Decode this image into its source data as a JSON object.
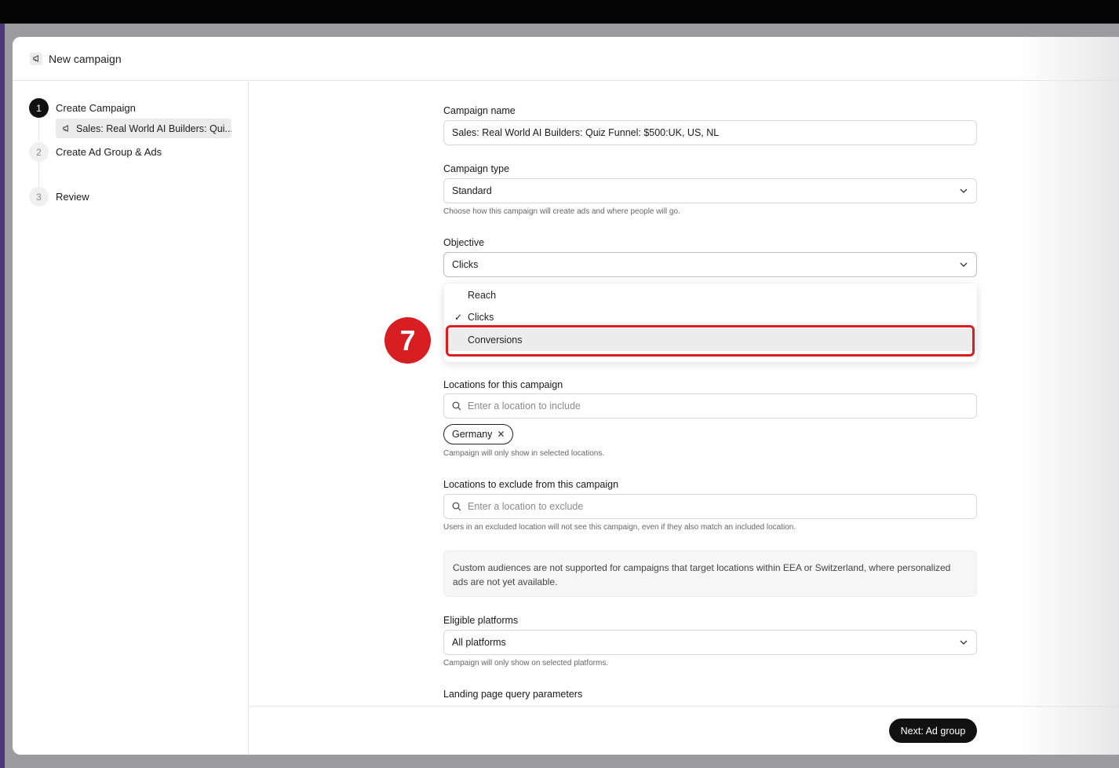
{
  "modal": {
    "title": "New campaign"
  },
  "steps": [
    {
      "num": "1",
      "label": "Create Campaign"
    },
    {
      "num": "2",
      "label": "Create Ad Group & Ads"
    },
    {
      "num": "3",
      "label": "Review"
    }
  ],
  "sub_item": "Sales: Real World AI Builders: Qui...",
  "form": {
    "campaign_name": {
      "label": "Campaign name",
      "value": "Sales: Real World AI Builders: Quiz Funnel: $500:UK, US, NL"
    },
    "campaign_type": {
      "label": "Campaign type",
      "value": "Standard",
      "helper": "Choose how this campaign will create ads and where people will go."
    },
    "objective": {
      "label": "Objective",
      "value": "Clicks",
      "options": [
        "Reach",
        "Clicks",
        "Conversions"
      ]
    },
    "locations": {
      "label": "Locations for this campaign",
      "placeholder": "Enter a location to include",
      "chip": "Germany",
      "helper": "Campaign will only show in selected locations."
    },
    "exclude": {
      "label": "Locations to exclude from this campaign",
      "placeholder": "Enter a location to exclude",
      "helper": "Users in an excluded location will not see this campaign, even if they also match an included location."
    },
    "notice": "Custom audiences are not supported for campaigns that target locations within EEA or Switzerland, where personalized ads are not yet available.",
    "platforms": {
      "label": "Eligible platforms",
      "value": "All platforms",
      "helper": "Campaign will only show on selected platforms."
    },
    "landing": {
      "label": "Landing page query parameters"
    }
  },
  "footer": {
    "next_label": "Next: Ad group"
  },
  "annotation": {
    "number": "7",
    "color": "#d61e23"
  }
}
